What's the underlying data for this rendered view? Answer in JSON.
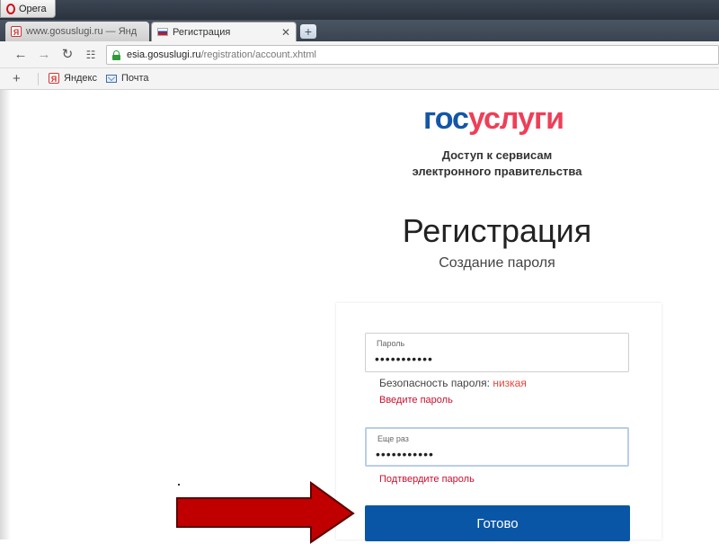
{
  "browser": {
    "app_button": "Opera",
    "tabs": [
      {
        "title": "www.gosuslugi.ru — Янд",
        "active": false
      },
      {
        "title": "Регистрация",
        "active": true
      }
    ],
    "new_tab_symbol": "+",
    "address": {
      "host": "esia.gosuslugi.ru",
      "path": "/registration/account.xhtml"
    },
    "bookmarks": [
      {
        "label": "Яндекс",
        "icon": "yandex-icon"
      },
      {
        "label": "Почта",
        "icon": "mail-icon"
      }
    ]
  },
  "page": {
    "logo": {
      "part1": "гос",
      "part2": "услуги"
    },
    "tagline_line1": "Доступ к сервисам",
    "tagline_line2": "электронного правительства",
    "title": "Регистрация",
    "subtitle": "Создание пароля",
    "form": {
      "password": {
        "label": "Пароль",
        "value": "•••••••••••"
      },
      "strength_label": "Безопасность пароля:",
      "strength_value": "низкая",
      "password_error": "Введите пароль",
      "confirm": {
        "label": "Еще раз",
        "value": "•••••••••••"
      },
      "confirm_error": "Подтвердите пароль",
      "submit_label": "Готово"
    }
  },
  "colors": {
    "brand_blue": "#1356a8",
    "brand_red": "#ee3f58",
    "button": "#0a56a6",
    "error": "#c8102e",
    "arrow": "#c00000"
  }
}
